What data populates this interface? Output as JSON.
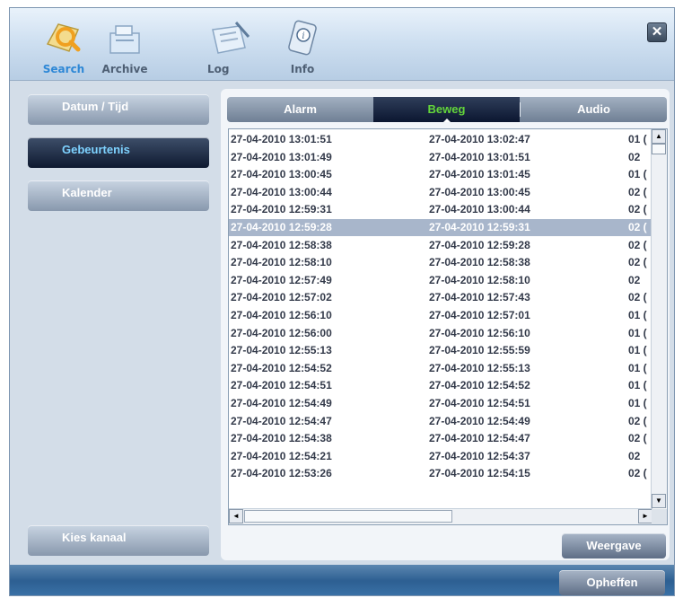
{
  "toolbar": {
    "items": [
      {
        "label": "Search",
        "icon": "search-icon",
        "active": true
      },
      {
        "label": "Archive",
        "icon": "archive-icon",
        "active": false
      },
      {
        "label": "Log",
        "icon": "log-icon",
        "active": false
      },
      {
        "label": "Info",
        "icon": "info-icon",
        "active": false
      }
    ],
    "close_label": "✕"
  },
  "sidebar": {
    "items": [
      {
        "label": "Datum / Tijd",
        "active": false
      },
      {
        "label": "Gebeurtenis",
        "active": true
      },
      {
        "label": "Kalender",
        "active": false
      }
    ],
    "channel_button": "Kies kanaal"
  },
  "tabs": [
    {
      "label": "Alarm",
      "active": false
    },
    {
      "label": "Beweg",
      "active": true
    },
    {
      "label": "Audio",
      "active": false
    }
  ],
  "list": {
    "rows": [
      {
        "start": "27-04-2010 13:01:51",
        "end": "27-04-2010 13:02:47",
        "ch": "01 (",
        "selected": false
      },
      {
        "start": "27-04-2010 13:01:49",
        "end": "27-04-2010 13:01:51",
        "ch": "02",
        "selected": false
      },
      {
        "start": "27-04-2010 13:00:45",
        "end": "27-04-2010 13:01:45",
        "ch": "01 (",
        "selected": false
      },
      {
        "start": "27-04-2010 13:00:44",
        "end": "27-04-2010 13:00:45",
        "ch": "02 (",
        "selected": false
      },
      {
        "start": "27-04-2010 12:59:31",
        "end": "27-04-2010 13:00:44",
        "ch": "02 (",
        "selected": false
      },
      {
        "start": "27-04-2010 12:59:28",
        "end": "27-04-2010 12:59:31",
        "ch": "02 (",
        "selected": true
      },
      {
        "start": "27-04-2010 12:58:38",
        "end": "27-04-2010 12:59:28",
        "ch": "02 (",
        "selected": false
      },
      {
        "start": "27-04-2010 12:58:10",
        "end": "27-04-2010 12:58:38",
        "ch": "02 (",
        "selected": false
      },
      {
        "start": "27-04-2010 12:57:49",
        "end": "27-04-2010 12:58:10",
        "ch": "02",
        "selected": false
      },
      {
        "start": "27-04-2010 12:57:02",
        "end": "27-04-2010 12:57:43",
        "ch": "02 (",
        "selected": false
      },
      {
        "start": "27-04-2010 12:56:10",
        "end": "27-04-2010 12:57:01",
        "ch": "01 (",
        "selected": false
      },
      {
        "start": "27-04-2010 12:56:00",
        "end": "27-04-2010 12:56:10",
        "ch": "01 (",
        "selected": false
      },
      {
        "start": "27-04-2010 12:55:13",
        "end": "27-04-2010 12:55:59",
        "ch": "01 (",
        "selected": false
      },
      {
        "start": "27-04-2010 12:54:52",
        "end": "27-04-2010 12:55:13",
        "ch": "01 (",
        "selected": false
      },
      {
        "start": "27-04-2010 12:54:51",
        "end": "27-04-2010 12:54:52",
        "ch": "01 (",
        "selected": false
      },
      {
        "start": "27-04-2010 12:54:49",
        "end": "27-04-2010 12:54:51",
        "ch": "01 (",
        "selected": false
      },
      {
        "start": "27-04-2010 12:54:47",
        "end": "27-04-2010 12:54:49",
        "ch": "02 (",
        "selected": false
      },
      {
        "start": "27-04-2010 12:54:38",
        "end": "27-04-2010 12:54:47",
        "ch": "02 (",
        "selected": false
      },
      {
        "start": "27-04-2010 12:54:21",
        "end": "27-04-2010 12:54:37",
        "ch": "02",
        "selected": false
      },
      {
        "start": "27-04-2010 12:53:26",
        "end": "27-04-2010 12:54:15",
        "ch": "02 (",
        "selected": false
      }
    ],
    "scroll_up": "▲",
    "scroll_down": "▼",
    "scroll_left": "◄",
    "scroll_right": "►"
  },
  "buttons": {
    "play": "Weergave",
    "cancel": "Opheffen"
  },
  "colors": {
    "active_tab_text": "#63d63a",
    "active_toolbar_text": "#2d87d6",
    "active_side_text": "#7ed2ff"
  }
}
